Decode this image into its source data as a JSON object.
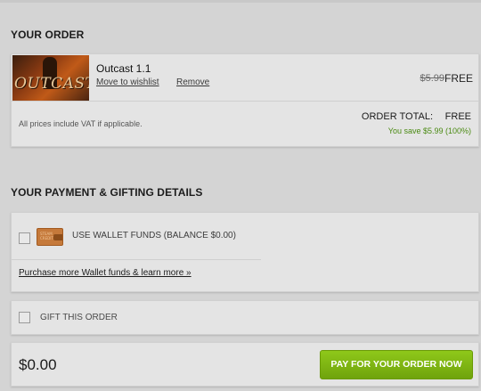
{
  "order": {
    "title": "YOUR ORDER",
    "item": {
      "name": "Outcast 1.1",
      "thumbnail_logo": "OUTCAST",
      "wishlist_link": "Move to wishlist",
      "remove_link": "Remove",
      "original_price": "$5.99",
      "price": "FREE"
    },
    "vat_note": "All prices include VAT if applicable.",
    "total_label": "ORDER TOTAL:",
    "total_value": "FREE",
    "savings": "You save $5.99 (100%)"
  },
  "payment": {
    "title": "YOUR PAYMENT & GIFTING DETAILS",
    "wallet_label": "USE WALLET FUNDS (BALANCE $0.00)",
    "wallet_icon_text": "STEAM CREDIT",
    "wallet_link": "Purchase more Wallet funds & learn more »",
    "gift_label": "GIFT THIS ORDER",
    "total": "$0.00",
    "pay_button": "PAY FOR YOUR ORDER NOW"
  },
  "colors": {
    "accent_green": "#6fa30c",
    "savings_green": "#4a8a12",
    "panel_bg": "#e4e4e4",
    "page_bg": "#d4d4d4"
  }
}
